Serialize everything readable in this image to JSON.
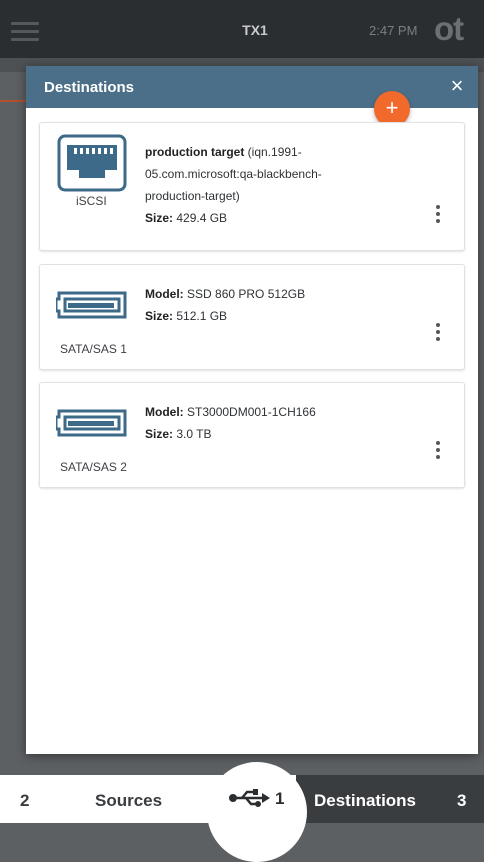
{
  "topbar": {
    "device": "TX1",
    "time": "2:47 PM",
    "logo": "ot"
  },
  "panel": {
    "title": "Destinations",
    "close_label": "×",
    "add_label": "+",
    "destinations": [
      {
        "type_label": "iSCSI",
        "icon": "ethernet-port-icon",
        "name": "production target",
        "detail_line1": "(iqn.1991-",
        "detail_line2": "05.com.microsoft:qa-blackbench-",
        "detail_line3": "production-target)",
        "size_label": "Size:",
        "size_value": "429.4 GB"
      },
      {
        "type_label": "SATA/SAS 1",
        "icon": "sata-port-icon",
        "model_label": "Model:",
        "model_value": "SSD 860 PRO 512GB",
        "size_label": "Size:",
        "size_value": "512.1 GB"
      },
      {
        "type_label": "SATA/SAS 2",
        "icon": "sata-port-icon",
        "model_label": "Model:",
        "model_value": "ST3000DM001-1CH166",
        "size_label": "Size:",
        "size_value": "3.0 TB"
      }
    ]
  },
  "bottom_nav": {
    "sources_count": "2",
    "sources_label": "Sources",
    "usb_count": "1",
    "destinations_label": "Destinations",
    "destinations_count": "3"
  },
  "colors": {
    "accent": "#f2692c",
    "header": "#4b6f88",
    "dark": "#2b2e31",
    "icon_blue": "#3d6a88"
  }
}
